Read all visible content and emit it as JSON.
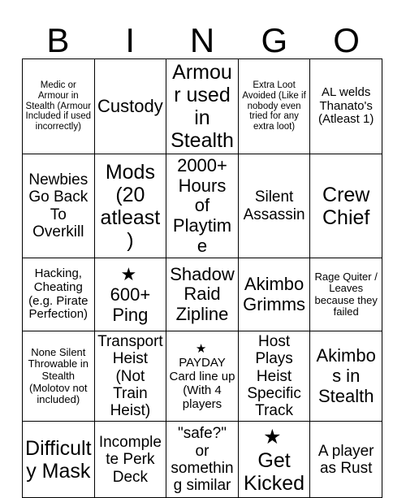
{
  "header": {
    "letters": [
      "B",
      "I",
      "N",
      "G",
      "O"
    ]
  },
  "grid": {
    "rows": [
      [
        {
          "text": "Medic or Armour in Stealth (Armour Included if used incorrectly)",
          "size": "xxs",
          "star": false
        },
        {
          "text": "Custody",
          "size": "lg",
          "star": false
        },
        {
          "text": "Armour used in Stealth",
          "size": "xl",
          "star": false
        },
        {
          "text": "Extra Loot Avoided (Like if nobody even tried for any extra loot)",
          "size": "xxs",
          "star": false
        },
        {
          "text": "AL welds Thanato's (Atleast 1)",
          "size": "sm",
          "star": false
        }
      ],
      [
        {
          "text": "Newbies Go Back To Overkill",
          "size": "md",
          "star": false
        },
        {
          "text": "Mods (20 atleast)",
          "size": "xl",
          "star": false
        },
        {
          "text": "2000+ Hours of Playtime",
          "size": "lg",
          "star": false
        },
        {
          "text": "Silent Assassin",
          "size": "md",
          "star": false
        },
        {
          "text": "Crew Chief",
          "size": "xl",
          "star": false
        }
      ],
      [
        {
          "text": "Hacking, Cheating (e.g. Pirate Perfection)",
          "size": "sm",
          "star": false
        },
        {
          "text": "600+ Ping",
          "size": "lg",
          "star": true
        },
        {
          "text": "Shadow Raid Zipline",
          "size": "lg",
          "star": false
        },
        {
          "text": "Akimbo Grimms",
          "size": "lg",
          "star": false
        },
        {
          "text": "Rage Quiter / Leaves because they failed",
          "size": "xs",
          "star": false
        }
      ],
      [
        {
          "text": "None Silent Throwable in Stealth (Molotov not included)",
          "size": "xs",
          "star": false
        },
        {
          "text": "Transport Heist (Not Train Heist)",
          "size": "md",
          "star": false
        },
        {
          "text": "PAYDAY Card line up (With 4 players",
          "size": "sm",
          "star": true
        },
        {
          "text": "Host Plays Heist Specific Track",
          "size": "md",
          "star": false
        },
        {
          "text": "Akimbos in Stealth",
          "size": "lg",
          "star": false
        }
      ],
      [
        {
          "text": "Difficulty Mask",
          "size": "xl",
          "star": false
        },
        {
          "text": "Incomplete Perk Deck",
          "size": "md",
          "star": false
        },
        {
          "text": "\"safe?\" or something similar",
          "size": "md",
          "star": false
        },
        {
          "text": "Get Kicked",
          "size": "xl",
          "star": true
        },
        {
          "text": "A player as Rust",
          "size": "md",
          "star": false
        }
      ]
    ]
  },
  "icons": {
    "star": "★"
  }
}
